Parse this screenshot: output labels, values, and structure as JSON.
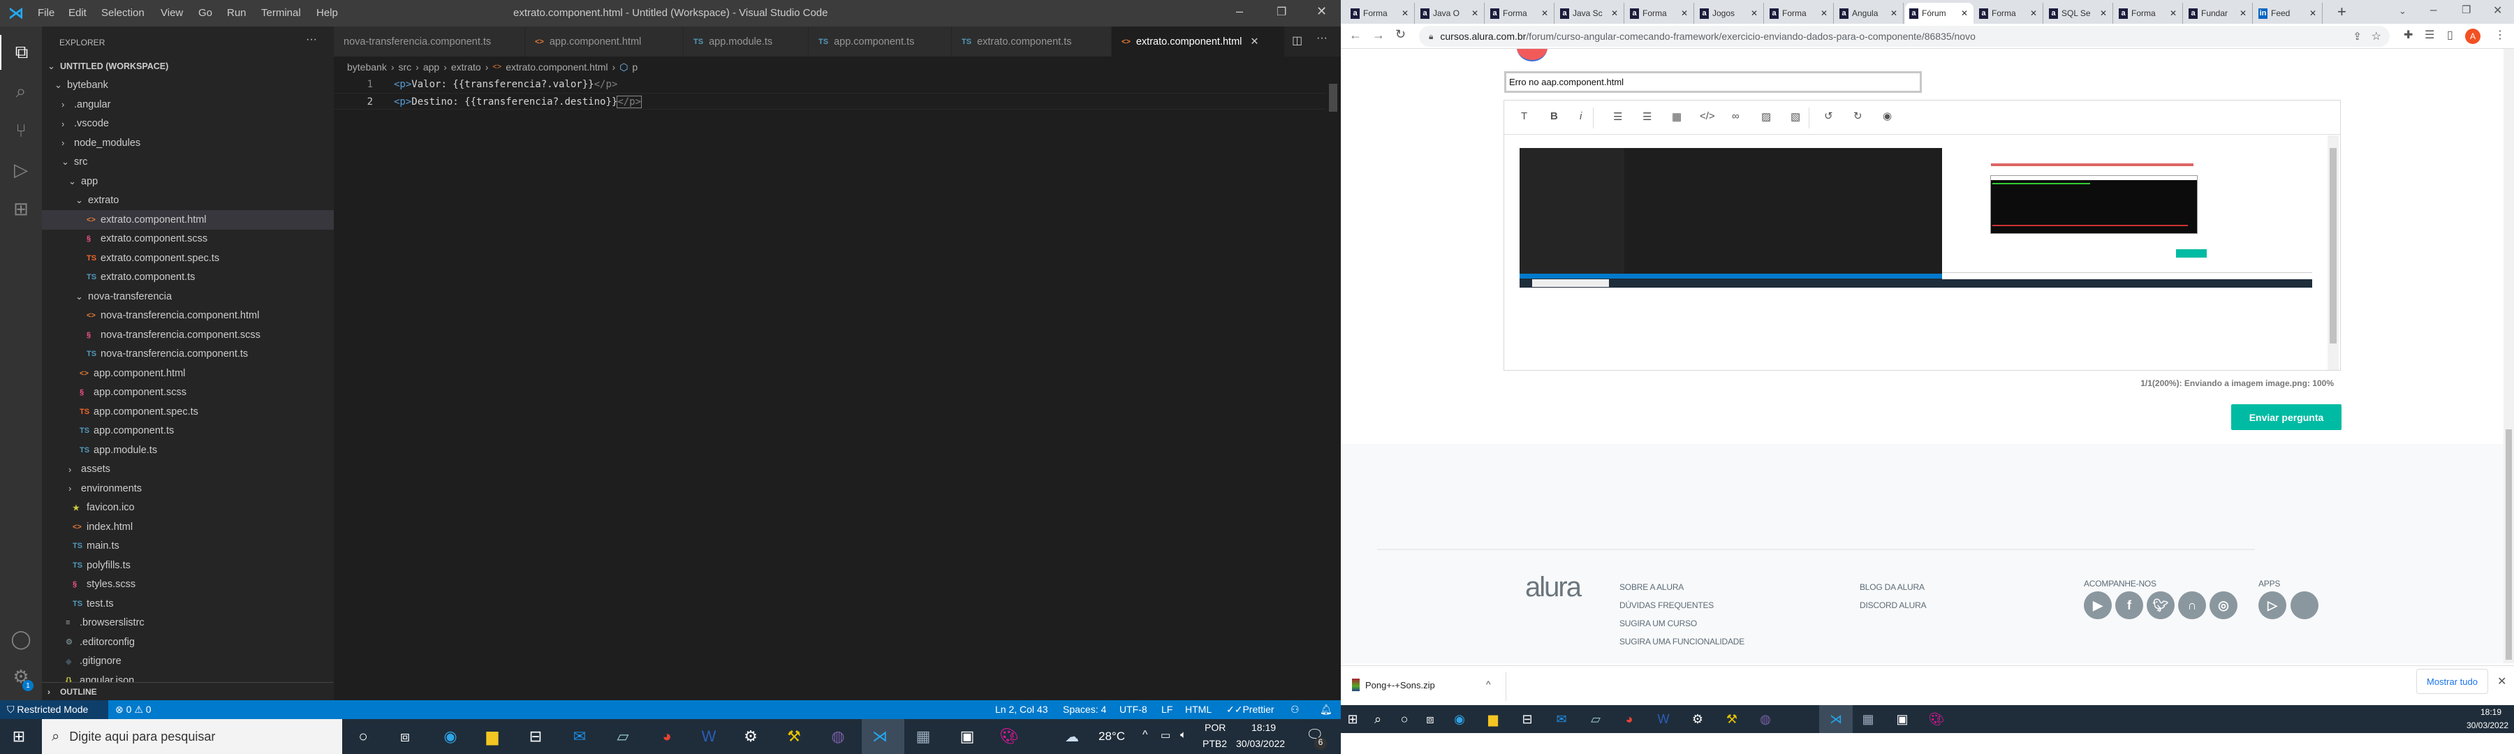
{
  "vscode": {
    "menu": [
      "File",
      "Edit",
      "Selection",
      "View",
      "Go",
      "Run",
      "Terminal",
      "Help"
    ],
    "window_title": "extrato.component.html - Untitled (Workspace) - Visual Studio Code",
    "explorer_title": "EXPLORER",
    "outline_label": "OUTLINE",
    "tree": [
      {
        "d": 0,
        "t": "open",
        "label": "UNTITLED (WORKSPACE)"
      },
      {
        "d": 1,
        "t": "open",
        "label": "bytebank"
      },
      {
        "d": 2,
        "t": "closed",
        "label": ".angular"
      },
      {
        "d": 2,
        "t": "closed",
        "label": ".vscode"
      },
      {
        "d": 2,
        "t": "closed",
        "label": "node_modules"
      },
      {
        "d": 2,
        "t": "open",
        "label": "src"
      },
      {
        "d": 3,
        "t": "open",
        "label": "app"
      },
      {
        "d": 4,
        "t": "open",
        "label": "extrato"
      },
      {
        "d": 5,
        "t": "html",
        "label": "extrato.component.html",
        "selected": true
      },
      {
        "d": 5,
        "t": "scss",
        "label": "extrato.component.scss"
      },
      {
        "d": 5,
        "t": "spec",
        "label": "extrato.component.spec.ts"
      },
      {
        "d": 5,
        "t": "ts",
        "label": "extrato.component.ts"
      },
      {
        "d": 4,
        "t": "open",
        "label": "nova-transferencia"
      },
      {
        "d": 5,
        "t": "html",
        "label": "nova-transferencia.component.html"
      },
      {
        "d": 5,
        "t": "scss",
        "label": "nova-transferencia.component.scss"
      },
      {
        "d": 5,
        "t": "ts",
        "label": "nova-transferencia.component.ts"
      },
      {
        "d": 4,
        "t": "html",
        "label": "app.component.html"
      },
      {
        "d": 4,
        "t": "scss",
        "label": "app.component.scss"
      },
      {
        "d": 4,
        "t": "spec",
        "label": "app.component.spec.ts"
      },
      {
        "d": 4,
        "t": "ts",
        "label": "app.component.ts"
      },
      {
        "d": 4,
        "t": "ts",
        "label": "app.module.ts"
      },
      {
        "d": 3,
        "t": "closed",
        "label": "assets"
      },
      {
        "d": 3,
        "t": "closed",
        "label": "environments"
      },
      {
        "d": 3,
        "t": "star",
        "label": "favicon.ico"
      },
      {
        "d": 3,
        "t": "html",
        "label": "index.html"
      },
      {
        "d": 3,
        "t": "ts",
        "label": "main.ts"
      },
      {
        "d": 3,
        "t": "ts",
        "label": "polyfills.ts"
      },
      {
        "d": 3,
        "t": "scss",
        "label": "styles.scss"
      },
      {
        "d": 3,
        "t": "ts",
        "label": "test.ts"
      },
      {
        "d": 2,
        "t": "list",
        "label": ".browserslistrc"
      },
      {
        "d": 2,
        "t": "gear",
        "label": ".editorconfig"
      },
      {
        "d": 2,
        "t": "git",
        "label": ".gitignore"
      },
      {
        "d": 2,
        "t": "json",
        "label": "angular.json"
      }
    ],
    "tabs": [
      {
        "label": "nova-transferencia.component.ts",
        "icon": "none"
      },
      {
        "label": "app.component.html",
        "icon": "html"
      },
      {
        "label": "app.module.ts",
        "icon": "ts"
      },
      {
        "label": "app.component.ts",
        "icon": "ts"
      },
      {
        "label": "extrato.component.ts",
        "icon": "ts"
      },
      {
        "label": "extrato.component.html",
        "icon": "html",
        "active": true
      }
    ],
    "breadcrumb": [
      "bytebank",
      "src",
      "app",
      "extrato",
      "extrato.component.html",
      "p"
    ],
    "code_lines": [
      {
        "num": "1",
        "open": "<p>",
        "text": "Valor: {{transferencia?.valor}}",
        "close": "</p>"
      },
      {
        "num": "2",
        "open": "<p>",
        "text": "Destino: {{transferencia?.destino}}",
        "close": "</p>"
      }
    ],
    "status": {
      "restricted": "Restricted Mode",
      "errors": "0",
      "warnings": "0",
      "position": "Ln 2, Col 43",
      "spaces": "Spaces: 4",
      "encoding": "UTF-8",
      "eol": "LF",
      "language": "HTML",
      "prettier": "Prettier"
    },
    "settings_badge": "1"
  },
  "taskbar": {
    "search_placeholder": "Digite aqui para pesquisar",
    "temperature": "28°C",
    "lang1": "POR",
    "lang2": "PTB2",
    "time": "18:19",
    "date": "30/03/2022",
    "notifications": "6"
  },
  "chrome": {
    "tabs": [
      "Forma",
      "Java O",
      "Forma",
      "Java Sc",
      "Forma",
      "Jogos",
      "Forma",
      "Angula",
      "Fórum",
      "Forma",
      "SQL Se",
      "Forma",
      "Fundar",
      "Feed"
    ],
    "active_tab": 8,
    "url_host": "cursos.alura.com.br",
    "url_path": "/forum/curso-angular-comecando-framework/exercicio-enviando-dados-para-o-componente/86835/novo",
    "profile_initial": "A",
    "title_input_value": "Erro no aap.component.html",
    "upload_status": "1/1(200%): Enviando a imagem image.png: 100%",
    "submit_label": "Enviar pergunta",
    "accent": "#00bba3",
    "footer": {
      "logo": "alura",
      "col1": [
        "SOBRE A ALURA",
        "DÚVIDAS FREQUENTES",
        "SUGIRA UM CURSO",
        "SUGIRA UMA FUNCIONALIDADE"
      ],
      "col2": [
        "BLOG DA ALURA",
        "DISCORD ALURA"
      ],
      "follow_title": "ACOMPANHE-NOS",
      "social": [
        "youtube-icon",
        "facebook-icon",
        "twitter-icon",
        "podcast-icon",
        "instagram-icon"
      ],
      "apps_title": "APPS",
      "apps": [
        "google-play-icon",
        "apple-icon"
      ]
    },
    "download": {
      "file": "Pong+-+Sons.zip",
      "show_all": "Mostrar tudo"
    }
  }
}
